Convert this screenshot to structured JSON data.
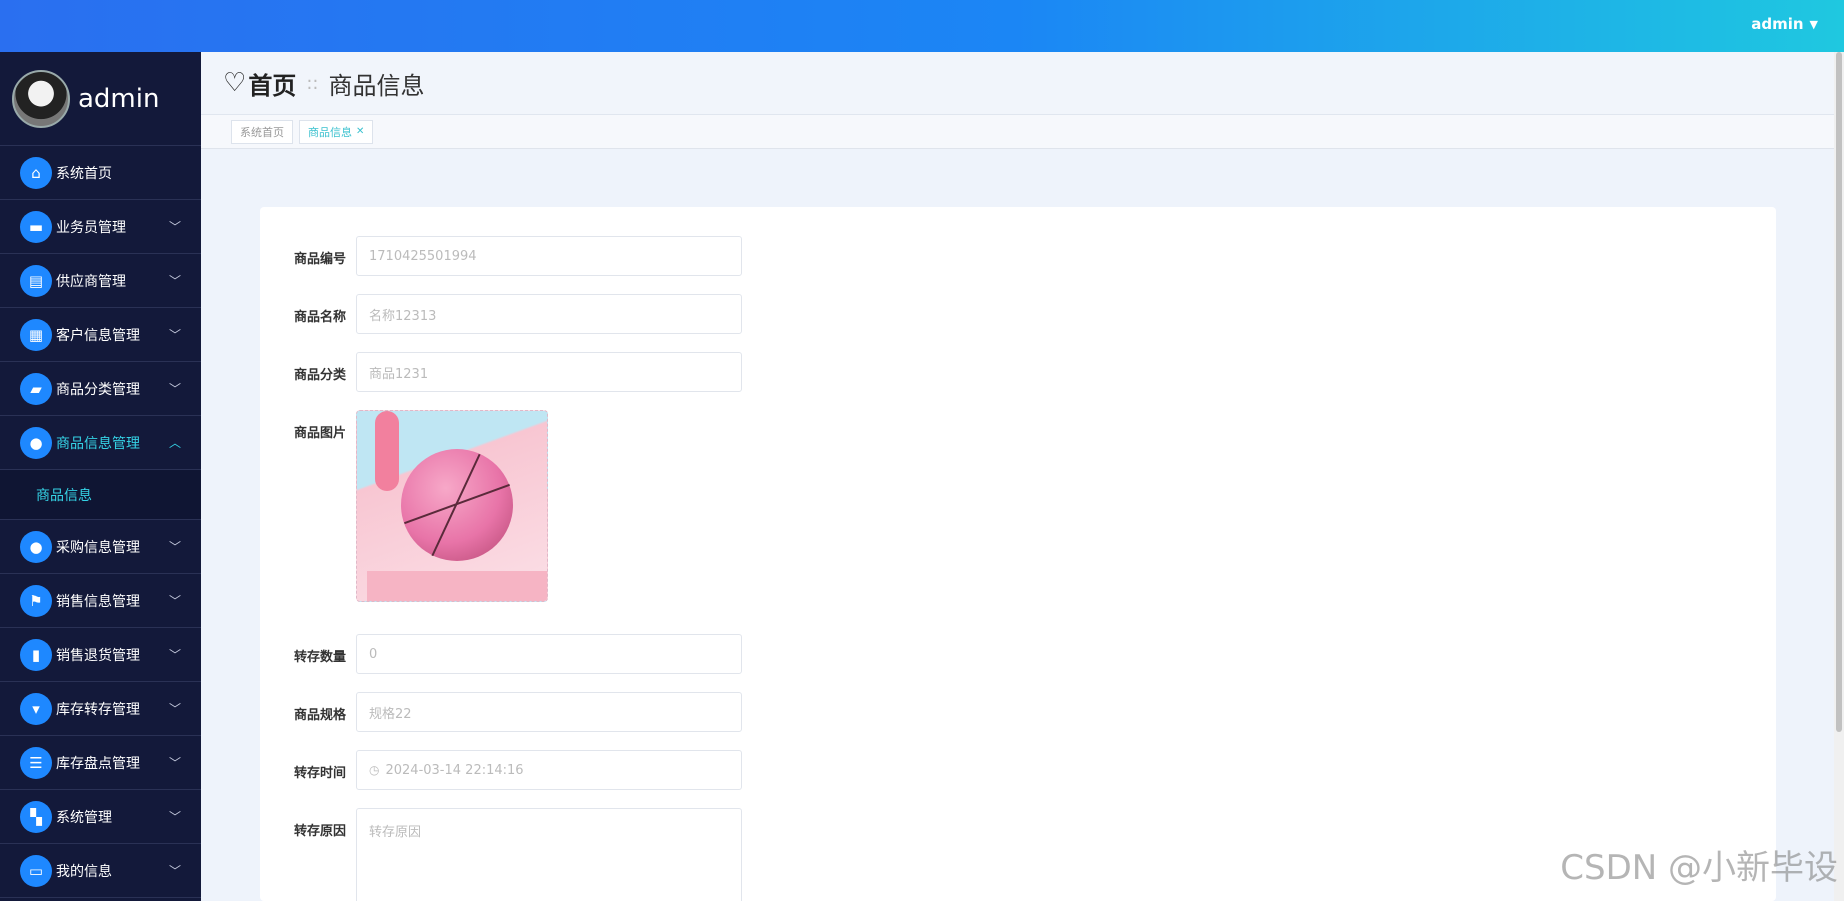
{
  "topbar": {
    "user": "admin"
  },
  "sidebar": {
    "username": "admin",
    "items": [
      {
        "label": "系统首页",
        "icon": "home-icon",
        "has_children": false
      },
      {
        "label": "业务员管理",
        "icon": "chat-icon",
        "has_children": true
      },
      {
        "label": "供应商管理",
        "icon": "clipboard-icon",
        "has_children": true
      },
      {
        "label": "客户信息管理",
        "icon": "grid-icon",
        "has_children": true
      },
      {
        "label": "商品分类管理",
        "icon": "folder-icon",
        "has_children": true
      },
      {
        "label": "商品信息管理",
        "icon": "user-icon",
        "has_children": true,
        "active": true,
        "children": [
          {
            "label": "商品信息"
          }
        ]
      },
      {
        "label": "采购信息管理",
        "icon": "bulb-icon",
        "has_children": true
      },
      {
        "label": "销售信息管理",
        "icon": "flag-icon",
        "has_children": true
      },
      {
        "label": "销售退货管理",
        "icon": "book-icon",
        "has_children": true
      },
      {
        "label": "库存转存管理",
        "icon": "monitor-icon",
        "has_children": true
      },
      {
        "label": "库存盘点管理",
        "icon": "list-icon",
        "has_children": true
      },
      {
        "label": "系统管理",
        "icon": "apps-icon",
        "has_children": true
      },
      {
        "label": "我的信息",
        "icon": "id-card-icon",
        "has_children": true
      }
    ]
  },
  "header": {
    "home": "首页",
    "current": "商品信息"
  },
  "tabs": [
    {
      "label": "系统首页",
      "active": false
    },
    {
      "label": "商品信息",
      "active": true
    }
  ],
  "form": {
    "code": {
      "label": "商品编号",
      "value": "1710425501994"
    },
    "name": {
      "label": "商品名称",
      "value": "名称12313"
    },
    "category": {
      "label": "商品分类",
      "value": "商品1231"
    },
    "image": {
      "label": "商品图片"
    },
    "quantity": {
      "label": "转存数量",
      "value": "0"
    },
    "spec": {
      "label": "商品规格",
      "value": "规格22"
    },
    "time": {
      "label": "转存时间",
      "value": "2024-03-14 22:14:16"
    },
    "reason": {
      "label": "转存原因",
      "placeholder": "转存原因"
    }
  },
  "watermark": "CSDN @小新毕设"
}
